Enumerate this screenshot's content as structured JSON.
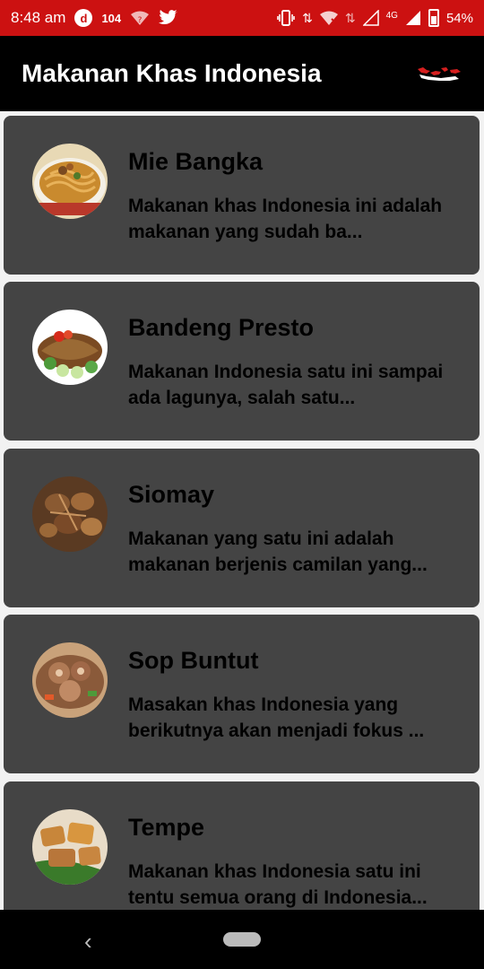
{
  "status_bar": {
    "time": "8:48 am",
    "notification_count": "104",
    "network_type": "4G",
    "battery": "54%"
  },
  "app_bar": {
    "title": "Makanan Khas Indonesia"
  },
  "foods": [
    {
      "name": "Mie Bangka",
      "description": "Makanan khas Indonesia ini adalah makanan yang sudah ba..."
    },
    {
      "name": "Bandeng Presto",
      "description": "Makanan Indonesia satu ini sampai ada lagunya, salah satu..."
    },
    {
      "name": "Siomay",
      "description": "Makanan yang satu ini adalah makanan berjenis camilan yang..."
    },
    {
      "name": "Sop Buntut",
      "description": "Masakan khas Indonesia yang berikutnya akan menjadi fokus ..."
    },
    {
      "name": "Tempe",
      "description": "Makanan khas Indonesia satu ini tentu semua orang di Indonesia..."
    }
  ],
  "colors": {
    "status_bar": "#cc1111",
    "app_bar": "#000000",
    "card": "#444444",
    "background": "#f2f2f2"
  }
}
